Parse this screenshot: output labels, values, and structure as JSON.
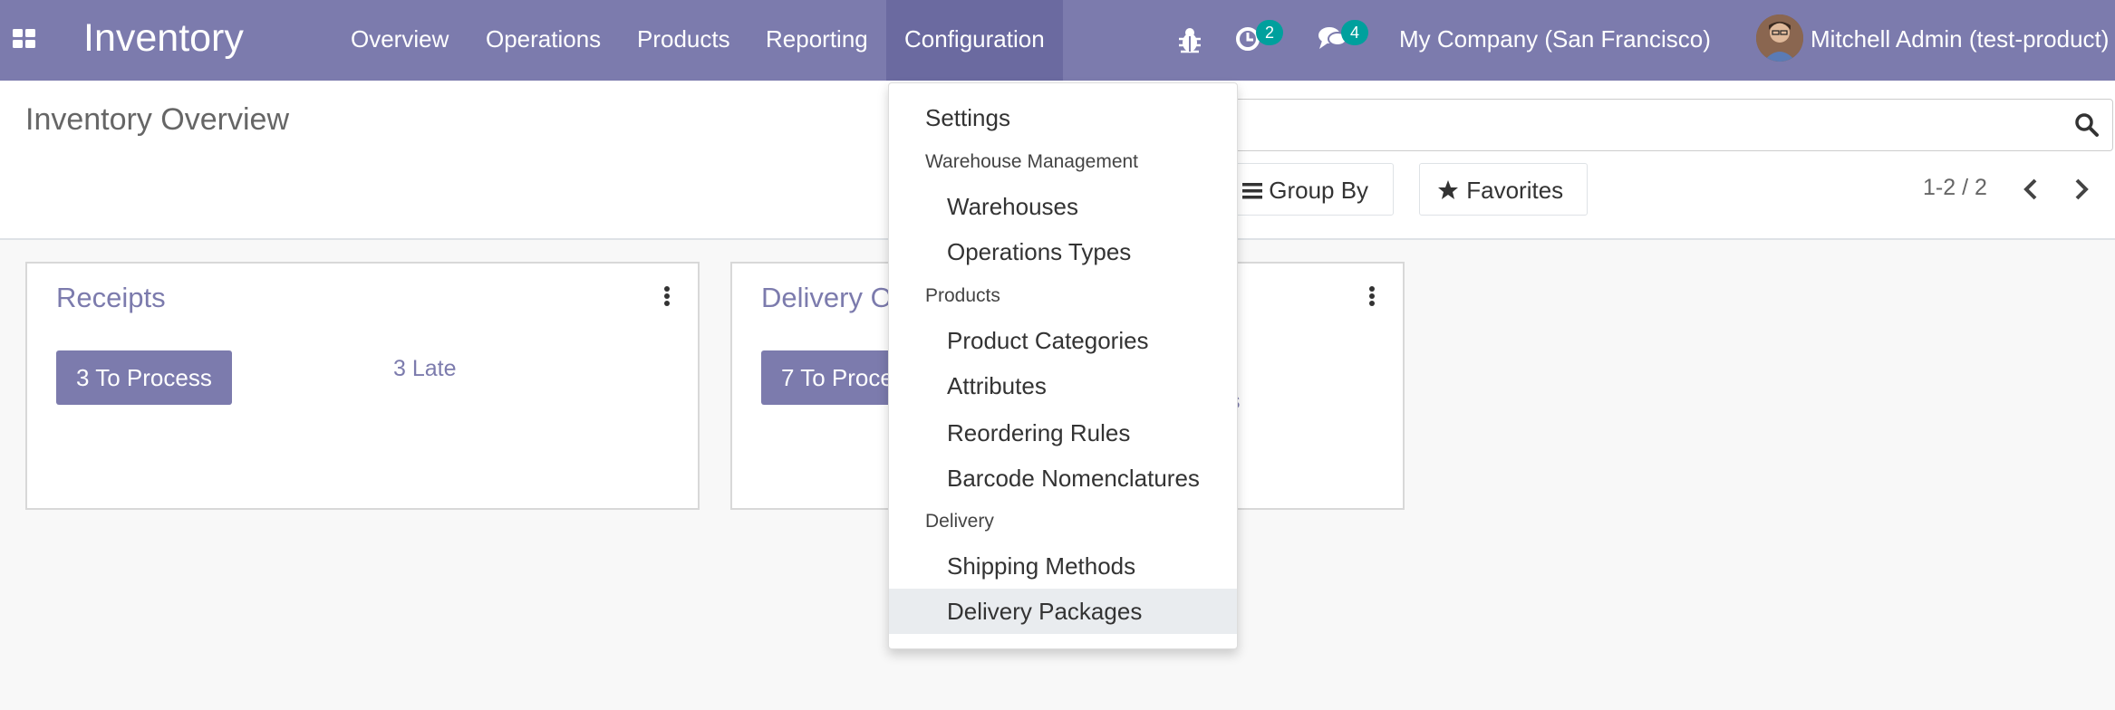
{
  "app": {
    "title": "Inventory"
  },
  "nav": {
    "items": [
      {
        "label": "Overview"
      },
      {
        "label": "Operations"
      },
      {
        "label": "Products"
      },
      {
        "label": "Reporting"
      },
      {
        "label": "Configuration"
      }
    ]
  },
  "systray": {
    "activity_count": "2",
    "messages_count": "4",
    "company": "My Company (San Francisco)",
    "user": "Mitchell Admin (test-product)"
  },
  "control_panel": {
    "title": "Inventory Overview",
    "group_by_label": "Group By",
    "favorites_label": "Favorites",
    "pager": "1-2 / 2"
  },
  "cards": [
    {
      "title": "Receipts",
      "button_label": "3 To Process",
      "late_label": "3 Late"
    },
    {
      "title": "Delivery O",
      "button_label": "7 To Proce",
      "partial_label": "s"
    }
  ],
  "dropdown": {
    "settings": "Settings",
    "sections": [
      {
        "header": "Warehouse Management",
        "items": [
          "Warehouses",
          "Operations Types"
        ]
      },
      {
        "header": "Products",
        "items": [
          "Product Categories",
          "Attributes",
          "Reordering Rules",
          "Barcode Nomenclatures"
        ]
      },
      {
        "header": "Delivery",
        "items": [
          "Shipping Methods",
          "Delivery Packages"
        ]
      }
    ]
  },
  "colors": {
    "brand": "#7c7bad",
    "badge": "#00a09d",
    "active_menu_item": "#e9ecef"
  },
  "icons": [
    "apps-icon",
    "bug-icon",
    "activity-icon",
    "chat-icon",
    "search-icon",
    "bars-icon",
    "star-icon",
    "chevron-left-icon",
    "chevron-right-icon",
    "kebab-menu-icon"
  ]
}
